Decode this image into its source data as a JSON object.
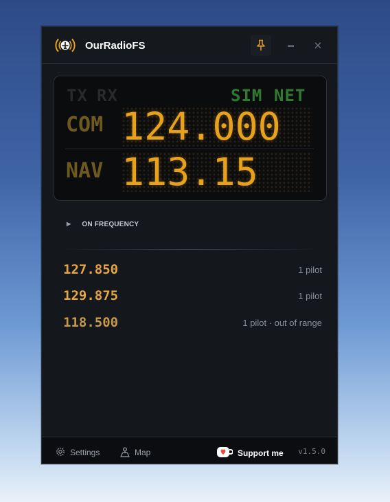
{
  "app": {
    "title": "OurRadioFS",
    "logo_icon": "radio-plane-icon"
  },
  "titlebar": {
    "pin_icon": "pin-icon",
    "minimize_icon": "minimize-icon",
    "close_icon": "close-icon"
  },
  "display": {
    "indicators": {
      "tx": "TX",
      "rx": "RX",
      "sim": "SIM",
      "net": "NET",
      "tx_active": false,
      "rx_active": false,
      "sim_active": true,
      "net_active": true
    },
    "com": {
      "label": "COM",
      "frequency": "124.000"
    },
    "nav": {
      "label": "NAV",
      "frequency": "113.15"
    }
  },
  "status": {
    "icon": "play-icon",
    "text": "ON FREQUENCY"
  },
  "frequencies": [
    {
      "freq": "127.850",
      "info": "1 pilot"
    },
    {
      "freq": "129.875",
      "info": "1 pilot"
    },
    {
      "freq": "118.500",
      "info": "1 pilot · out of range"
    }
  ],
  "footer": {
    "settings_label": "Settings",
    "map_label": "Map",
    "support_label": "Support me",
    "version": "v1.5.0"
  },
  "colors": {
    "accent": "#e8a11c",
    "window_bg": "#14171c",
    "indicator_on": "#2f7a2f",
    "indicator_off": "#2a2a2a"
  }
}
